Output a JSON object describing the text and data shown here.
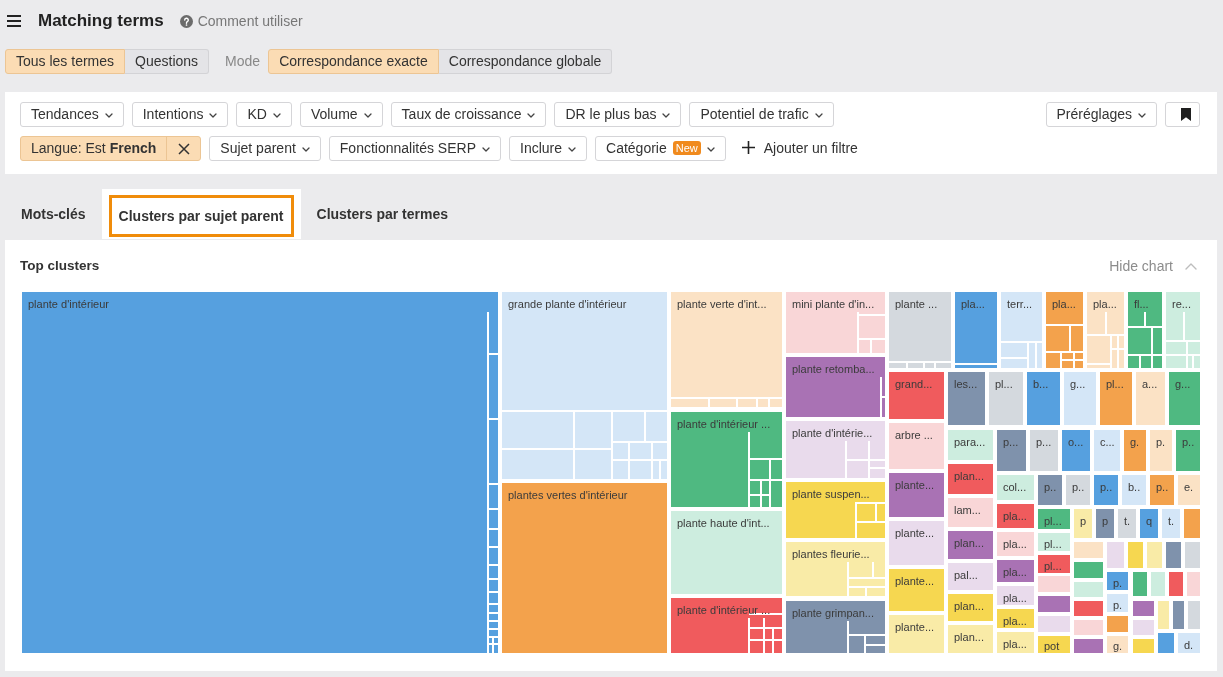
{
  "header": {
    "title": "Matching terms",
    "help": "Comment utiliser"
  },
  "term_filter": [
    {
      "label": "Tous les termes",
      "selected": true
    },
    {
      "label": "Questions",
      "selected": false
    }
  ],
  "mode": {
    "label": "Mode",
    "options": [
      {
        "label": "Correspondance exacte",
        "selected": true
      },
      {
        "label": "Correspondance globale",
        "selected": false
      }
    ]
  },
  "filters": {
    "top_row": [
      {
        "kind": "dropdown",
        "label": "Tendances"
      },
      {
        "kind": "dropdown",
        "label": "Intentions"
      },
      {
        "kind": "dropdown",
        "label": "KD"
      },
      {
        "kind": "dropdown",
        "label": "Volume"
      },
      {
        "kind": "dropdown",
        "label": "Taux de croissance"
      },
      {
        "kind": "dropdown",
        "label": "DR le plus bas"
      },
      {
        "kind": "dropdown",
        "label": "Potentiel de trafic"
      }
    ],
    "presets": "Préréglages",
    "bottom_row": [
      {
        "kind": "chip",
        "label": "Langue: Est **French**"
      },
      {
        "kind": "dropdown",
        "label": "Sujet parent"
      },
      {
        "kind": "dropdown",
        "label": "Fonctionnalités SERP"
      },
      {
        "kind": "dropdown",
        "label": "Inclure"
      },
      {
        "kind": "dropdown",
        "label": "Catégorie",
        "badge": "New"
      },
      {
        "kind": "add",
        "label": "Ajouter un filtre"
      }
    ]
  },
  "tabs": [
    {
      "label": "Mots-clés",
      "selected": false
    },
    {
      "label": "Clusters par sujet parent",
      "selected": true
    },
    {
      "label": "Clusters par termes",
      "selected": false
    }
  ],
  "chart": {
    "title": "Top clusters",
    "toggle": "Hide chart",
    "clusters": [
      {
        "label": "plante d'intérieur",
        "color": "#56a0df"
      },
      {
        "label": "grande plante d'intérieur",
        "color": "#d4e6f7"
      },
      {
        "label": "plantes vertes d'intérieur",
        "color": "#f3a24c"
      },
      {
        "label": "plante verte d'int...",
        "color": "#fbe2c5"
      },
      {
        "label": "plante d'intérieur ...",
        "color": "#4fb981"
      },
      {
        "label": "plante haute d'int...",
        "color": "#cdeddf"
      },
      {
        "label": "plante d'intérieur ...",
        "color": "#f05b5d"
      },
      {
        "label": "mini plante d'in...",
        "color": "#f9d6d7"
      },
      {
        "label": "plante retomba...",
        "color": "#a972b4"
      },
      {
        "label": "plante d'intérie...",
        "color": "#e9dbec"
      },
      {
        "label": "plante suspen...",
        "color": "#f6d750"
      },
      {
        "label": "plantes fleurie...",
        "color": "#f9eba7"
      },
      {
        "label": "plante grimpan...",
        "color": "#7f92ac"
      },
      {
        "label": "plante ...",
        "color": "#d4d9de"
      },
      {
        "label": "pla...",
        "color": "#56a0df"
      },
      {
        "label": "terr...",
        "color": "#d4e6f7"
      },
      {
        "label": "pla...",
        "color": "#f3a24c"
      },
      {
        "label": "pla...",
        "color": "#fbe2c5"
      },
      {
        "label": "fl...",
        "color": "#4fb981"
      },
      {
        "label": "re...",
        "color": "#cdeddf"
      },
      {
        "label": "grand...",
        "color": "#f05b5d"
      },
      {
        "label": "arbre ...",
        "color": "#f9d6d7"
      },
      {
        "label": "plante...",
        "color": "#a972b4"
      },
      {
        "label": "plante...",
        "color": "#e9dbec"
      },
      {
        "label": "plante...",
        "color": "#f6d750"
      },
      {
        "label": "plante...",
        "color": "#f9eba7"
      },
      {
        "label": "les...",
        "color": "#7f92ac"
      },
      {
        "label": "pl...",
        "color": "#d4d9de"
      },
      {
        "label": "b...",
        "color": "#56a0df"
      },
      {
        "label": "g...",
        "color": "#d4e6f7"
      },
      {
        "label": "pl...",
        "color": "#f3a24c"
      },
      {
        "label": "a...",
        "color": "#fbe2c5"
      },
      {
        "label": "g...",
        "color": "#4fb981"
      },
      {
        "label": "para...",
        "color": "#cdeddf"
      },
      {
        "label": "plan...",
        "color": "#f05b5d"
      },
      {
        "label": "lam...",
        "color": "#f9d6d7"
      },
      {
        "label": "plan...",
        "color": "#a972b4"
      },
      {
        "label": "pal...",
        "color": "#e9dbec"
      },
      {
        "label": "plan...",
        "color": "#f6d750"
      },
      {
        "label": "plan...",
        "color": "#f9eba7"
      },
      {
        "label": "p...",
        "color": "#7f92ac"
      },
      {
        "label": "p...",
        "color": "#d4d9de"
      },
      {
        "label": "o...",
        "color": "#56a0df"
      },
      {
        "label": "c...",
        "color": "#d4e6f7"
      },
      {
        "label": "g.",
        "color": "#f3a24c"
      },
      {
        "label": "p.",
        "color": "#fbe2c5"
      },
      {
        "label": "p..",
        "color": "#4fb981"
      },
      {
        "label": "col...",
        "color": "#cdeddf"
      },
      {
        "label": "pla...",
        "color": "#f05b5d"
      },
      {
        "label": "pla...",
        "color": "#f9d6d7"
      },
      {
        "label": "pla...",
        "color": "#a972b4"
      },
      {
        "label": "pla...",
        "color": "#e9dbec"
      },
      {
        "label": "pla...",
        "color": "#f6d750"
      },
      {
        "label": "pla...",
        "color": "#f9eba7"
      },
      {
        "label": "p..",
        "color": "#7f92ac"
      },
      {
        "label": "p..",
        "color": "#d4d9de"
      },
      {
        "label": "p..",
        "color": "#56a0df"
      },
      {
        "label": "b..",
        "color": "#d4e6f7"
      },
      {
        "label": "p..",
        "color": "#f3a24c"
      },
      {
        "label": "e.",
        "color": "#fbe2c5"
      },
      {
        "label": "pl...",
        "color": "#4fb981"
      },
      {
        "label": "pl...",
        "color": "#cdeddf"
      },
      {
        "label": "pl...",
        "color": "#f05b5d"
      },
      {
        "color": "#f9d6d7"
      },
      {
        "color": "#a972b4"
      },
      {
        "color": "#e9dbec"
      },
      {
        "label": "pot",
        "color": "#f6d750"
      },
      {
        "label": "p",
        "color": "#f9eba7"
      },
      {
        "label": "p",
        "color": "#7f92ac"
      },
      {
        "label": "t.",
        "color": "#d4d9de"
      },
      {
        "label": "q",
        "color": "#56a0df"
      },
      {
        "label": "t.",
        "color": "#d4e6f7"
      },
      {
        "color": "#f3a24c"
      },
      {
        "color": "#fbe2c5"
      },
      {
        "color": "#4fb981"
      },
      {
        "color": "#cdeddf"
      },
      {
        "color": "#f05b5d"
      },
      {
        "color": "#f9d6d7"
      },
      {
        "color": "#a972b4"
      },
      {
        "color": "#e9dbec"
      },
      {
        "color": "#f6d750"
      },
      {
        "color": "#f9eba7"
      },
      {
        "color": "#7f92ac"
      },
      {
        "color": "#d4d9de"
      },
      {
        "label": "p.",
        "color": "#56a0df"
      },
      {
        "label": "p.",
        "color": "#d4e6f7"
      },
      {
        "color": "#f3a24c"
      },
      {
        "label": "g.",
        "color": "#fbe2c5"
      },
      {
        "color": "#4fb981"
      },
      {
        "color": "#cdeddf"
      },
      {
        "color": "#f05b5d"
      },
      {
        "color": "#f9d6d7"
      },
      {
        "color": "#a972b4"
      },
      {
        "color": "#e9dbec"
      },
      {
        "color": "#f6d750"
      },
      {
        "color": "#f9eba7"
      },
      {
        "color": "#7f92ac"
      },
      {
        "color": "#d4d9de"
      },
      {
        "color": "#56a0df"
      },
      {
        "label": "d.",
        "color": "#d4e6f7"
      }
    ]
  }
}
